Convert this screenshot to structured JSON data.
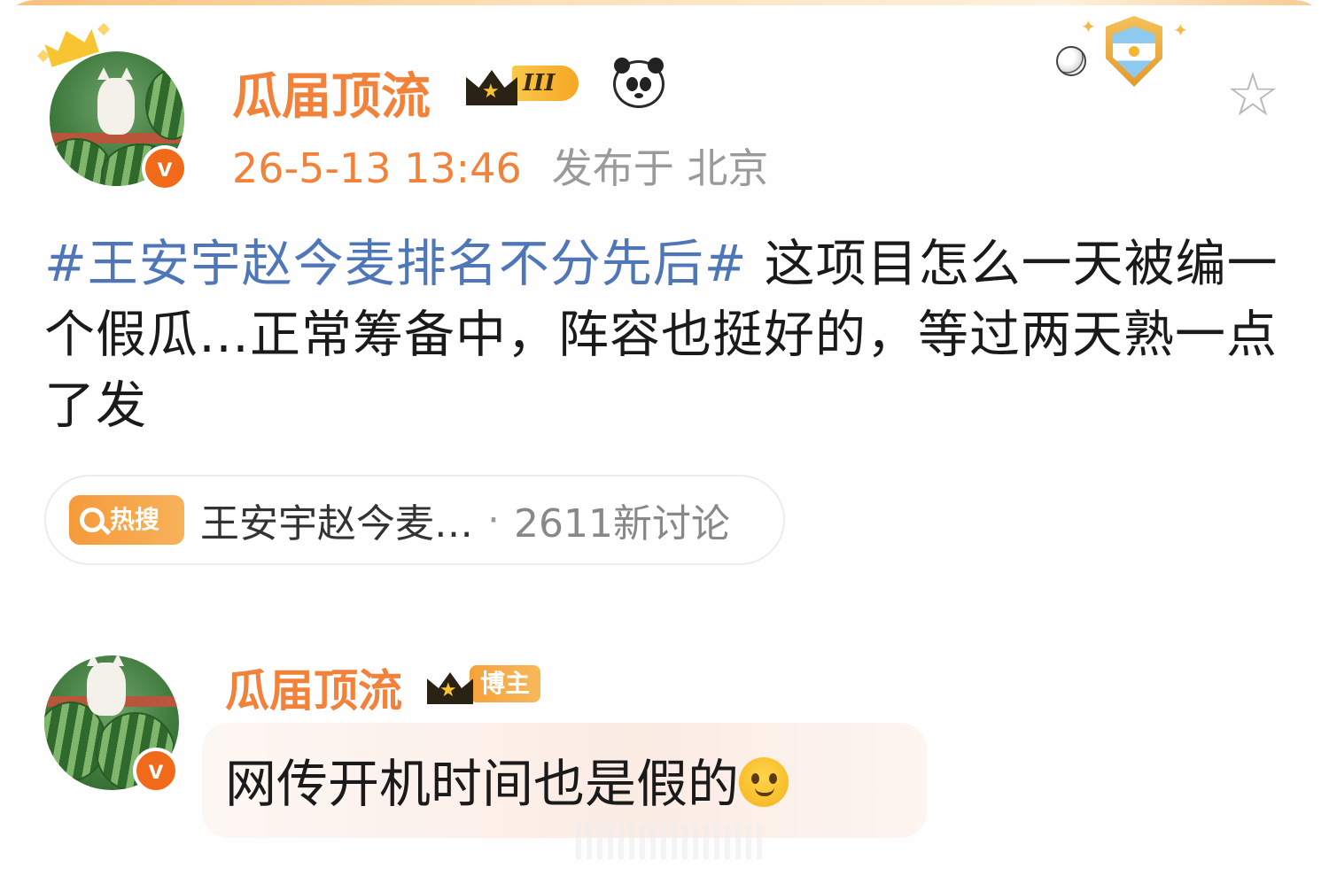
{
  "post": {
    "author": "瓜届顶流",
    "vip_level": "III",
    "timestamp": "26-5-13 13:46",
    "location": "发布于 北京",
    "hashtag": "#王安宇赵今麦排名不分先后#",
    "body": " 这项目怎么一天被编一个假瓜…正常筹备中，阵容也挺好的，等过两天熟一点了发"
  },
  "hot_search": {
    "label": "热搜",
    "title": "王安宇赵今麦…",
    "separator": "·",
    "count": "2611新讨论"
  },
  "reply": {
    "author": "瓜届顶流",
    "role_tag": "博主",
    "text": "网传开机时间也是假的"
  },
  "icons": {
    "verified": "v-verified-icon",
    "favorite": "star-outline-icon",
    "panda": "panda-emoji-icon",
    "trophy": "argentina-trophy-icon"
  },
  "colors": {
    "username": "#f2813a",
    "hashtag": "#4f76b8",
    "hot_label": "#f59a3b"
  }
}
